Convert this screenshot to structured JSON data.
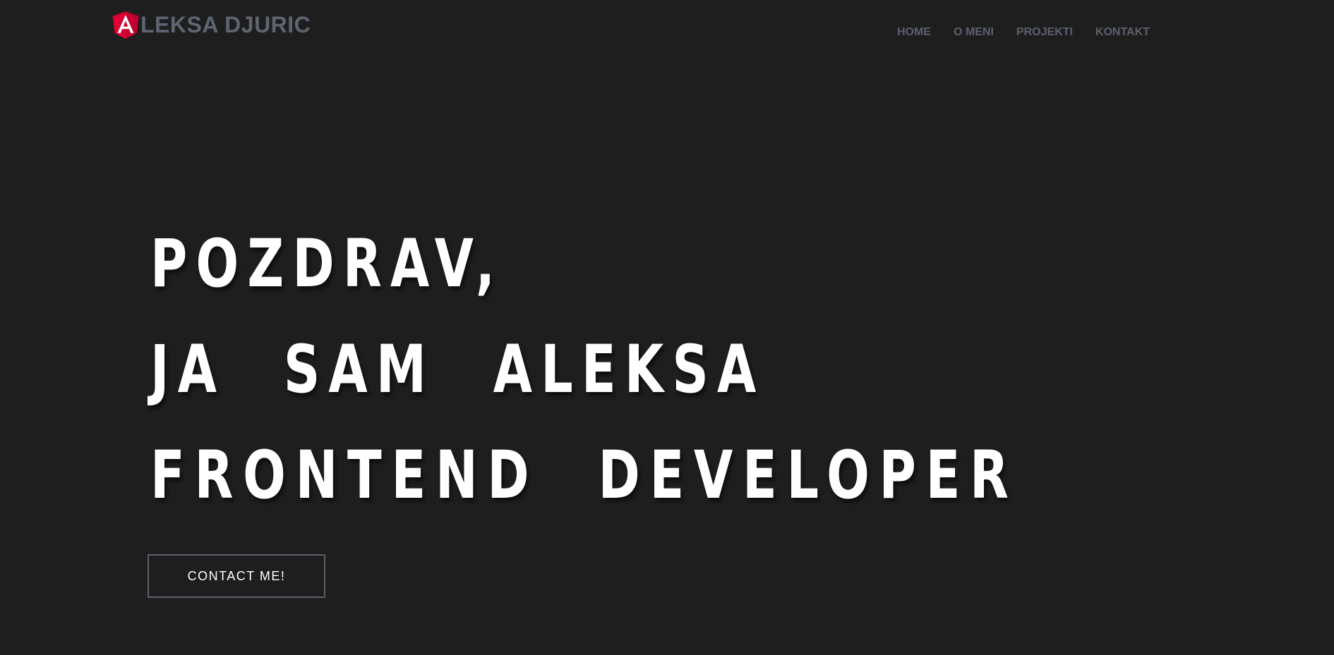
{
  "brand": {
    "logo_icon": "angular-shield-icon",
    "logo_letter": "A",
    "name": "LEKSA DJURIC",
    "logo_color": "#dd0031"
  },
  "nav": {
    "items": [
      {
        "label": "HOME"
      },
      {
        "label": "O MENI"
      },
      {
        "label": "PROJEKTI"
      },
      {
        "label": "KONTAKT"
      }
    ]
  },
  "hero": {
    "line1": "POZDRAV,",
    "line2": "JA SAM ALEKSA",
    "line3": "FRONTEND DEVELOPER",
    "cta_label": "CONTACT ME!"
  },
  "colors": {
    "background": "#1e1e1f",
    "nav_text": "#5b616b",
    "hero_text": "#ffffff",
    "button_border": "#5a606b"
  }
}
